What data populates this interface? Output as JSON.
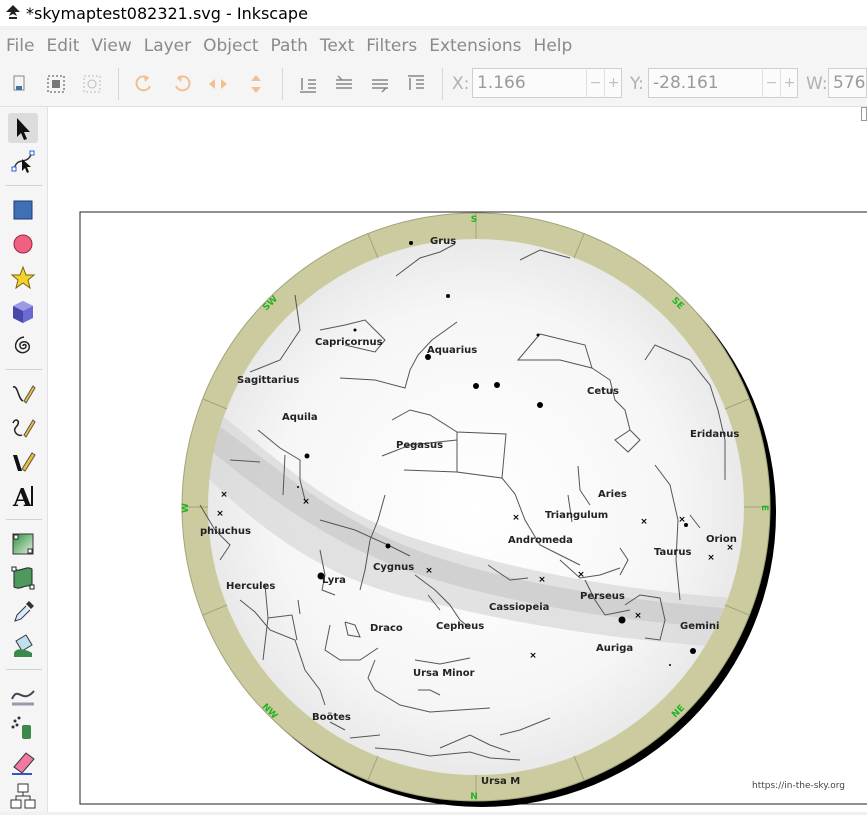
{
  "window": {
    "title": "*skymaptest082321.svg - Inkscape"
  },
  "menu": [
    "File",
    "Edit",
    "View",
    "Layer",
    "Object",
    "Path",
    "Text",
    "Filters",
    "Extensions",
    "Help"
  ],
  "toolbar": {
    "x_label": "X:",
    "x_value": "1.166",
    "y_label": "Y:",
    "y_value": "-28.161",
    "w_label": "W:",
    "w_value": "576.",
    "minus": "−",
    "plus": "+"
  },
  "tools": [
    "selector",
    "node",
    "rectangle",
    "ellipse",
    "star",
    "3d-box",
    "spiral",
    "pencil",
    "pen",
    "calligraphy",
    "text",
    "gradient",
    "mesh",
    "dropper",
    "paint-bucket",
    "tweak",
    "spray",
    "eraser",
    "connector"
  ],
  "skymap": {
    "directions": {
      "top": "S",
      "bottom": "N",
      "left": "W",
      "right": "E",
      "top_left": "SW",
      "top_right": "SE",
      "bottom_left": "NW",
      "bottom_right": "NE"
    },
    "constellations": [
      "Grus",
      "Capricornus",
      "Aquarius",
      "Sagittarius",
      "Cetus",
      "Aquila",
      "Eridanus",
      "Pegasus",
      "Aries",
      "Triangulum",
      "Andromeda",
      "phiuchus",
      "Orion",
      "Taurus",
      "Cygnus",
      "Lyra",
      "Hercules",
      "Perseus",
      "Cassiopeia",
      "Draco",
      "Cepheus",
      "Gemini",
      "Auriga",
      "Ursa Minor",
      "Boötes",
      "Ursa M"
    ],
    "credit": "https://in-the-sky.org"
  },
  "colors": {
    "ring": "#cbcb9f",
    "ring_label": "#22b322",
    "star": "#000000",
    "line": "#555555"
  }
}
